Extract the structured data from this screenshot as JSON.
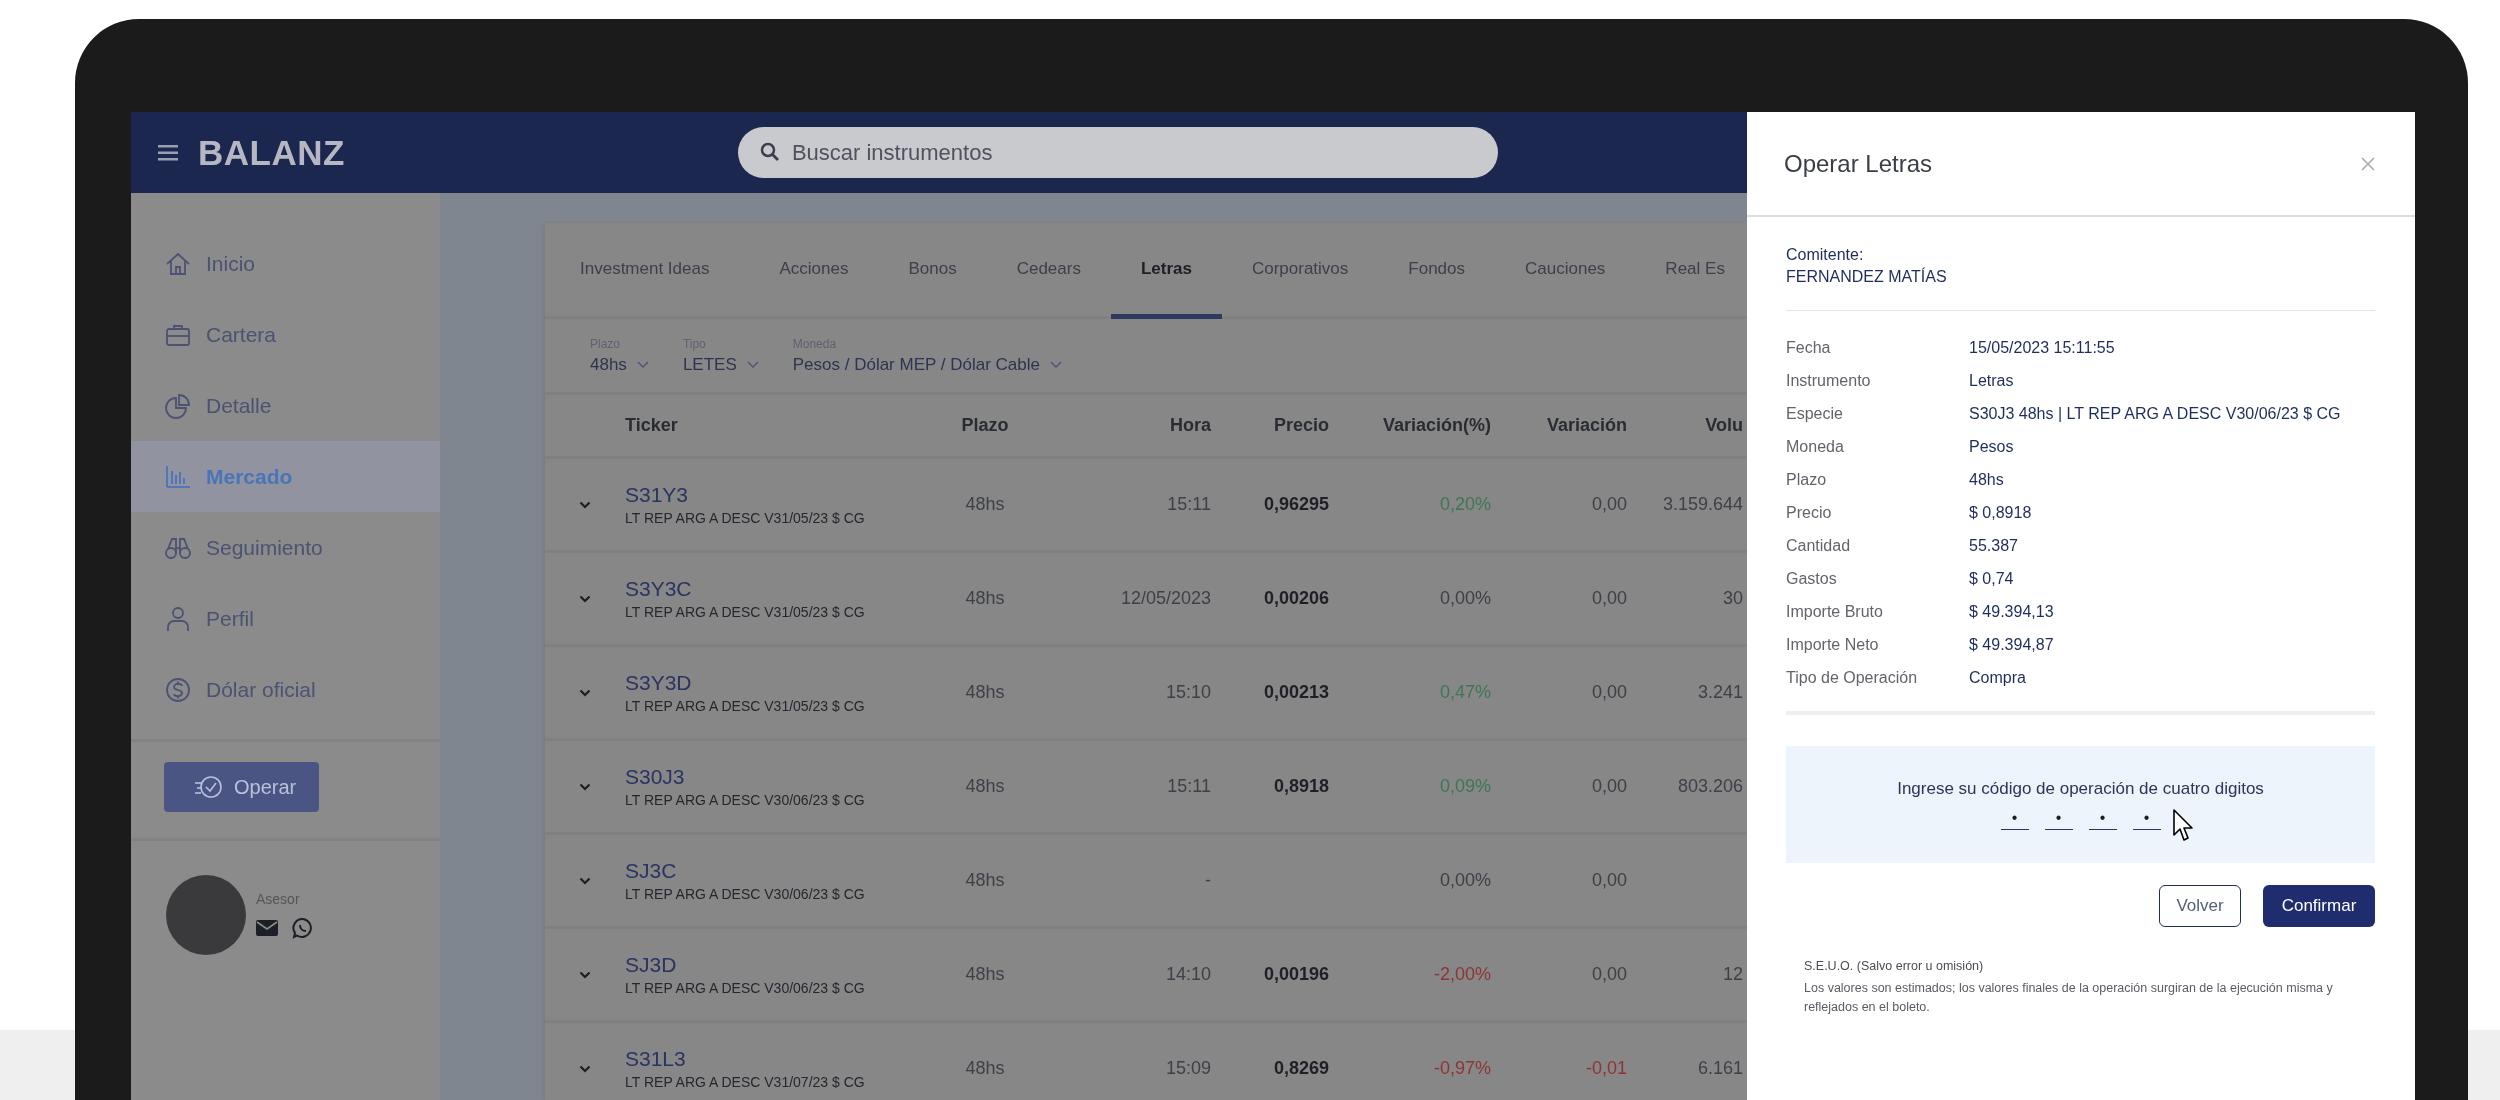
{
  "header": {
    "brand": "BALANZ",
    "search": {
      "placeholder": "Buscar instrumentos"
    }
  },
  "sidebar": {
    "items": [
      {
        "label": "Inicio",
        "selected": false
      },
      {
        "label": "Cartera",
        "selected": false
      },
      {
        "label": "Detalle",
        "selected": false
      },
      {
        "label": "Mercado",
        "selected": true
      },
      {
        "label": "Seguimiento",
        "selected": false
      },
      {
        "label": "Perfil",
        "selected": false
      },
      {
        "label": "Dólar oficial",
        "selected": false
      }
    ],
    "operate_button": "Operar",
    "advisor": {
      "label": "Asesor"
    }
  },
  "market": {
    "tabs": [
      {
        "label": "Investment Ideas",
        "selected": false
      },
      {
        "label": "Acciones",
        "selected": false
      },
      {
        "label": "Bonos",
        "selected": false
      },
      {
        "label": "Cedears",
        "selected": false
      },
      {
        "label": "Letras",
        "selected": true
      },
      {
        "label": "Corporativos",
        "selected": false
      },
      {
        "label": "Fondos",
        "selected": false
      },
      {
        "label": "Cauciones",
        "selected": false
      },
      {
        "label": "Real Es",
        "selected": false
      }
    ],
    "filters": [
      {
        "label": "Plazo",
        "value": "48hs"
      },
      {
        "label": "Tipo",
        "value": "LETES"
      },
      {
        "label": "Moneda",
        "value": "Pesos / Dólar MEP / Dólar Cable"
      }
    ],
    "table": {
      "columns": [
        "Ticker",
        "Plazo",
        "Hora",
        "Precio",
        "Variación(%)",
        "Variación",
        "Volu"
      ],
      "rows": [
        {
          "ticker": "S31Y3",
          "description": "LT REP ARG A DESC V31/05/23 $ CG",
          "plazo": "48hs",
          "hora": "15:11",
          "precio": "0,96295",
          "variacion_pct": {
            "text": "0,20%",
            "color": "#3e7656"
          },
          "variacion": {
            "text": "0,00",
            "color": "#3e4048"
          },
          "volumen": "3.159.644"
        },
        {
          "ticker": "S3Y3C",
          "description": "LT REP ARG A DESC V31/05/23 $ CG",
          "plazo": "48hs",
          "hora": "12/05/2023",
          "precio": "0,00206",
          "variacion_pct": {
            "text": "0,00%",
            "color": "#3e4048"
          },
          "variacion": {
            "text": "0,00",
            "color": "#3e4048"
          },
          "volumen": "30"
        },
        {
          "ticker": "S3Y3D",
          "description": "LT REP ARG A DESC V31/05/23 $ CG",
          "plazo": "48hs",
          "hora": "15:10",
          "precio": "0,00213",
          "variacion_pct": {
            "text": "0,47%",
            "color": "#3e7656"
          },
          "variacion": {
            "text": "0,00",
            "color": "#3e4048"
          },
          "volumen": "3.241"
        },
        {
          "ticker": "S30J3",
          "description": "LT REP ARG A DESC V30/06/23 $ CG",
          "plazo": "48hs",
          "hora": "15:11",
          "precio": "0,8918",
          "variacion_pct": {
            "text": "0,09%",
            "color": "#3e7656"
          },
          "variacion": {
            "text": "0,00",
            "color": "#3e4048"
          },
          "volumen": "803.206"
        },
        {
          "ticker": "SJ3C",
          "description": "LT REP ARG A DESC V30/06/23 $ CG",
          "plazo": "48hs",
          "hora": "-",
          "precio": "",
          "variacion_pct": {
            "text": "0,00%",
            "color": "#3e4048"
          },
          "variacion": {
            "text": "0,00",
            "color": "#3e4048"
          },
          "volumen": ""
        },
        {
          "ticker": "SJ3D",
          "description": "LT REP ARG A DESC V30/06/23 $ CG",
          "plazo": "48hs",
          "hora": "14:10",
          "precio": "0,00196",
          "variacion_pct": {
            "text": "-2,00%",
            "color": "#8f3434"
          },
          "variacion": {
            "text": "0,00",
            "color": "#3e4048"
          },
          "volumen": "12"
        },
        {
          "ticker": "S31L3",
          "description": "LT REP ARG A DESC V31/07/23 $ CG",
          "plazo": "48hs",
          "hora": "15:09",
          "precio": "0,8269",
          "variacion_pct": {
            "text": "-0,97%",
            "color": "#8f3434"
          },
          "variacion": {
            "text": "-0,01",
            "color": "#8f3434"
          },
          "volumen": "6.161"
        }
      ]
    }
  },
  "panel": {
    "title": "Operar Letras",
    "client_label": "Comitente:",
    "client_name": "FERNANDEZ MATÍAS",
    "details": [
      {
        "label": "Fecha",
        "value": "15/05/2023 15:11:55"
      },
      {
        "label": "Instrumento",
        "value": "Letras"
      },
      {
        "label": "Especie",
        "value": "S30J3 48hs | LT REP ARG A DESC V30/06/23 $ CG"
      },
      {
        "label": "Moneda",
        "value": "Pesos"
      },
      {
        "label": "Plazo",
        "value": "48hs"
      },
      {
        "label": "Precio",
        "value": "$ 0,8918"
      },
      {
        "label": "Cantidad",
        "value": "55.387"
      },
      {
        "label": "Gastos",
        "value": "$ 0,74"
      },
      {
        "label": "Importe Bruto",
        "value": "$ 49.394,13"
      },
      {
        "label": "Importe Neto",
        "value": "$ 49.394,87"
      },
      {
        "label": "Tipo de Operación",
        "value": "Compra"
      }
    ],
    "code": {
      "prompt": "Ingrese su código de operación de cuatro digitos",
      "digits": [
        "•",
        "•",
        "•",
        "•"
      ]
    },
    "buttons": {
      "back": "Volver",
      "confirm": "Confirmar"
    },
    "disclaimer": {
      "title": "S.E.U.O. (Salvo error u omisión)",
      "text": "Los valores son estimados; los valores finales de la operación surgiran de la ejecución misma y reflejados en el boleto."
    }
  }
}
